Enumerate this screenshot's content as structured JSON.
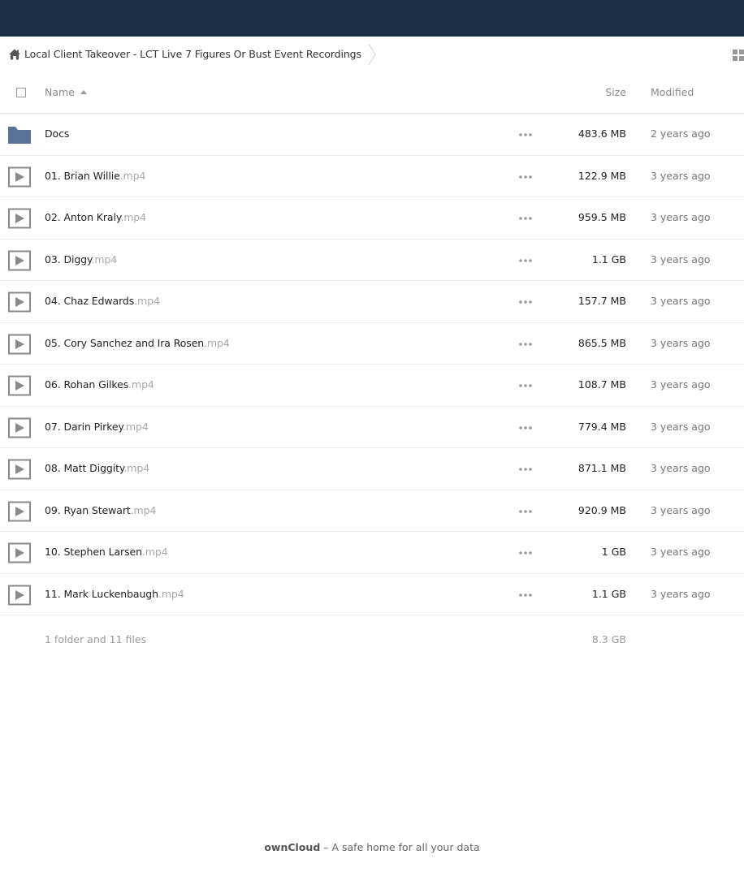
{
  "breadcrumb": {
    "current_folder": "Local Client Takeover - LCT Live 7 Figures Or Bust Event Recordings"
  },
  "table_header": {
    "name": "Name",
    "size": "Size",
    "modified": "Modified"
  },
  "files": [
    {
      "type": "folder",
      "name": "Docs",
      "ext": "",
      "size": "483.6 MB",
      "modified": "2 years ago"
    },
    {
      "type": "video",
      "name": "01. Brian Willie",
      "ext": ".mp4",
      "size": "122.9 MB",
      "modified": "3 years ago"
    },
    {
      "type": "video",
      "name": "02. Anton Kraly",
      "ext": ".mp4",
      "size": "959.5 MB",
      "modified": "3 years ago"
    },
    {
      "type": "video",
      "name": "03. Diggy",
      "ext": ".mp4",
      "size": "1.1 GB",
      "modified": "3 years ago"
    },
    {
      "type": "video",
      "name": "04. Chaz Edwards",
      "ext": ".mp4",
      "size": "157.7 MB",
      "modified": "3 years ago"
    },
    {
      "type": "video",
      "name": "05. Cory Sanchez and Ira Rosen",
      "ext": ".mp4",
      "size": "865.5 MB",
      "modified": "3 years ago"
    },
    {
      "type": "video",
      "name": "06. Rohan Gilkes",
      "ext": ".mp4",
      "size": "108.7 MB",
      "modified": "3 years ago"
    },
    {
      "type": "video",
      "name": "07. Darin Pirkey",
      "ext": ".mp4",
      "size": "779.4 MB",
      "modified": "3 years ago"
    },
    {
      "type": "video",
      "name": "08. Matt Diggity",
      "ext": ".mp4",
      "size": "871.1 MB",
      "modified": "3 years ago"
    },
    {
      "type": "video",
      "name": "09. Ryan Stewart",
      "ext": ".mp4",
      "size": "920.9 MB",
      "modified": "3 years ago"
    },
    {
      "type": "video",
      "name": "10. Stephen Larsen",
      "ext": ".mp4",
      "size": "1 GB",
      "modified": "3 years ago"
    },
    {
      "type": "video",
      "name": "11. Mark Luckenbaugh",
      "ext": ".mp4",
      "size": "1.1 GB",
      "modified": "3 years ago"
    }
  ],
  "summary": {
    "count": "1 folder and 11 files",
    "total_size": "8.3 GB"
  },
  "footer": {
    "brand": "ownCloud",
    "tagline": " – A safe home for all your data"
  },
  "colors": {
    "topbar": "#1d2d44",
    "folder_icon": "#5b7397",
    "video_icon": "#8a8a8a"
  },
  "icons": {
    "home": "home-icon",
    "folder": "folder-icon",
    "video": "video-file-icon",
    "more": "more-actions-icon",
    "view_toggle": "grid-view-icon"
  }
}
